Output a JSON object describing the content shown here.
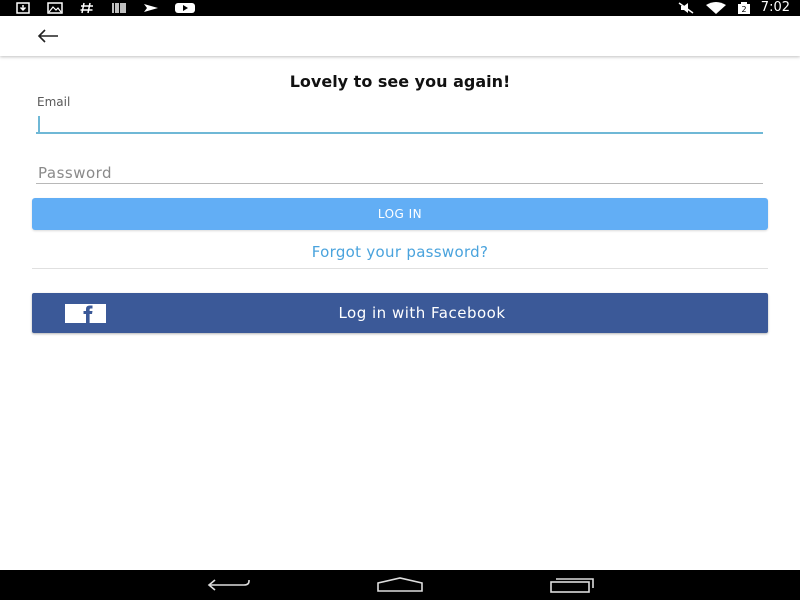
{
  "status_bar": {
    "time": "7:02",
    "left_icons": [
      "download-icon",
      "image-icon",
      "hash-icon",
      "barcode-icon",
      "send-icon",
      "youtube-icon"
    ],
    "right_icons": [
      "mute-icon",
      "wifi-icon",
      "battery-icon"
    ],
    "battery_text": "2"
  },
  "app_bar": {
    "back_icon": "arrow-left-icon"
  },
  "login": {
    "heading": "Lovely to see you again!",
    "email_label": "Email",
    "email_value": "",
    "password_placeholder": "Password",
    "login_button": "LOG IN",
    "forgot_link": "Forgot your password?",
    "facebook_button": "Log in with Facebook",
    "facebook_icon": "facebook-icon"
  },
  "nav_bar": {
    "items": [
      "back-icon",
      "home-icon",
      "recents-icon"
    ]
  },
  "colors": {
    "login_button": "#62aef5",
    "facebook_button": "#3b5998",
    "link": "#4aa3dd",
    "email_underline": "#6fb8d6"
  }
}
